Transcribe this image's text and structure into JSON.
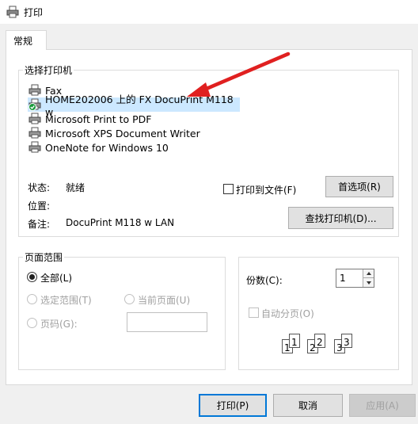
{
  "window": {
    "title": "打印"
  },
  "tabs": [
    {
      "label": "常规"
    }
  ],
  "printer_group": {
    "label": "选择打印机",
    "printers": [
      {
        "name": "Fax"
      },
      {
        "name": "HOME202006 上的 FX DocuPrint M118 w"
      },
      {
        "name": "Microsoft Print to PDF"
      },
      {
        "name": "Microsoft XPS Document Writer"
      },
      {
        "name": "OneNote for Windows 10"
      }
    ],
    "selected_index": 1,
    "status_label": "状态:",
    "status_value": "就绪",
    "location_label": "位置:",
    "location_value": "",
    "comment_label": "备注:",
    "comment_value": "DocuPrint M118 w LAN",
    "print_to_file_label": "打印到文件(F)",
    "print_to_file_checked": false,
    "preferences_button": "首选项(R)",
    "find_printer_button": "查找打印机(D)..."
  },
  "page_range": {
    "label": "页面范围",
    "all_label": "全部(L)",
    "selection_label": "选定范围(T)",
    "current_page_label": "当前页面(U)",
    "pages_label": "页码(G):",
    "pages_value": ""
  },
  "copies": {
    "label": "份数(C):",
    "value": "1",
    "collate_label": "自动分页(O)",
    "collate_checked": false
  },
  "buttons": {
    "print": "打印(P)",
    "cancel": "取消",
    "apply": "应用(A)"
  },
  "colors": {
    "selection": "#cce8ff",
    "accent": "#0078d7",
    "arrow": "#e02020"
  }
}
